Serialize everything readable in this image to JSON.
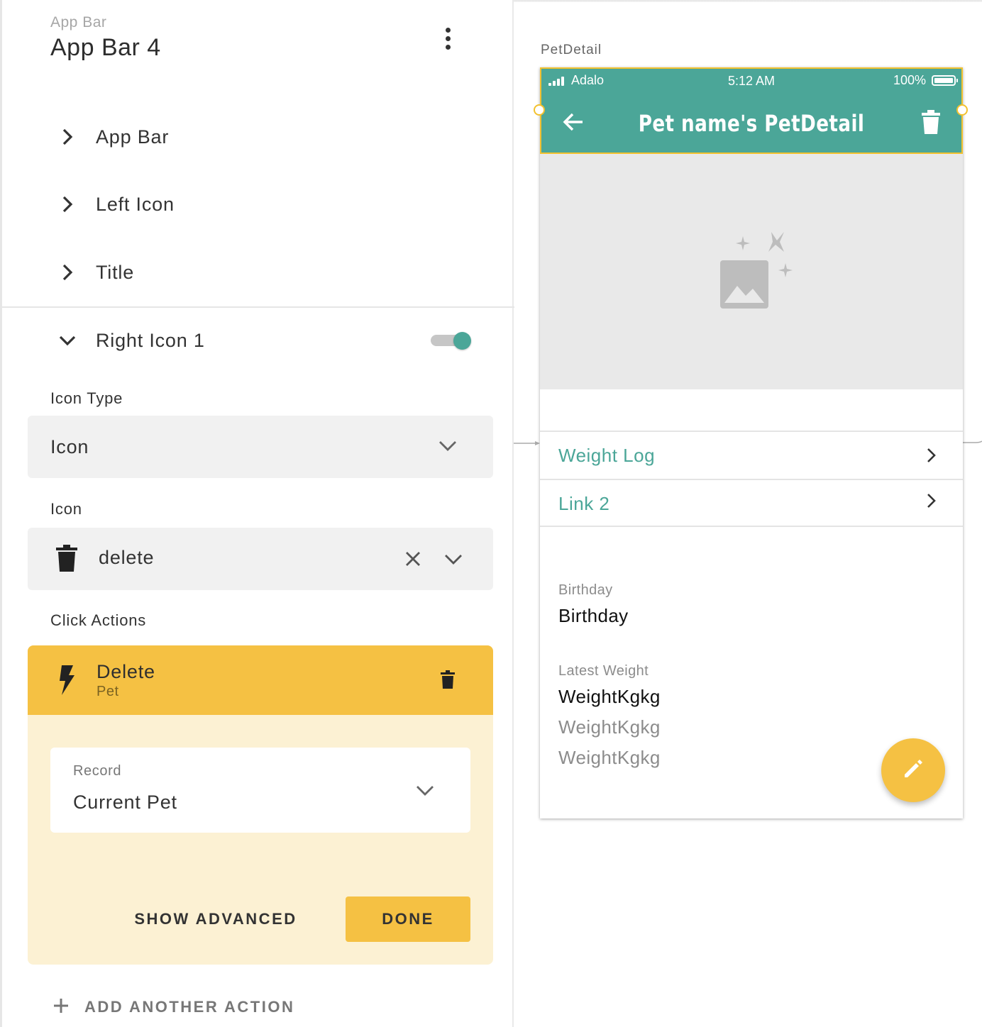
{
  "sidebar": {
    "component_kind": "App Bar",
    "component_name": "App Bar 4",
    "sections": [
      {
        "label": "App Bar"
      },
      {
        "label": "Left Icon"
      },
      {
        "label": "Title"
      },
      {
        "label": "Right Icon 1"
      }
    ],
    "right_icon_enabled": true,
    "icon_type": {
      "label": "Icon Type",
      "value": "Icon"
    },
    "icon": {
      "label": "Icon",
      "value": "delete",
      "icon_name": "delete-icon"
    },
    "click_actions": {
      "label": "Click Actions",
      "action": {
        "title": "Delete",
        "subtitle": "Pet",
        "icon_name": "lightning-icon"
      },
      "record": {
        "label": "Record",
        "value": "Current Pet"
      },
      "show_advanced_label": "SHOW ADVANCED",
      "done_label": "DONE"
    },
    "add_action_label": "ADD ANOTHER ACTION"
  },
  "canvas": {
    "screen_name": "PetDetail",
    "status_bar": {
      "carrier": "Adalo",
      "time": "5:12 AM",
      "battery": "100%"
    },
    "app_bar": {
      "title": "Pet name's PetDetail",
      "left_icon": "arrow-back-icon",
      "right_icon": "delete-icon"
    },
    "links": [
      {
        "label": "Weight Log"
      },
      {
        "label": "Link 2"
      }
    ],
    "birthday": {
      "label": "Birthday",
      "value": "Birthday"
    },
    "latest_weight": {
      "label": "Latest Weight",
      "values": [
        "WeightKgkg",
        "WeightKgkg",
        "WeightKgkg"
      ]
    },
    "fab_icon": "pencil-icon"
  },
  "colors": {
    "accent_teal": "#4ba698",
    "accent_yellow": "#f5c143",
    "action_body": "#fcf1d3",
    "selection_outline": "#f2c12e"
  }
}
